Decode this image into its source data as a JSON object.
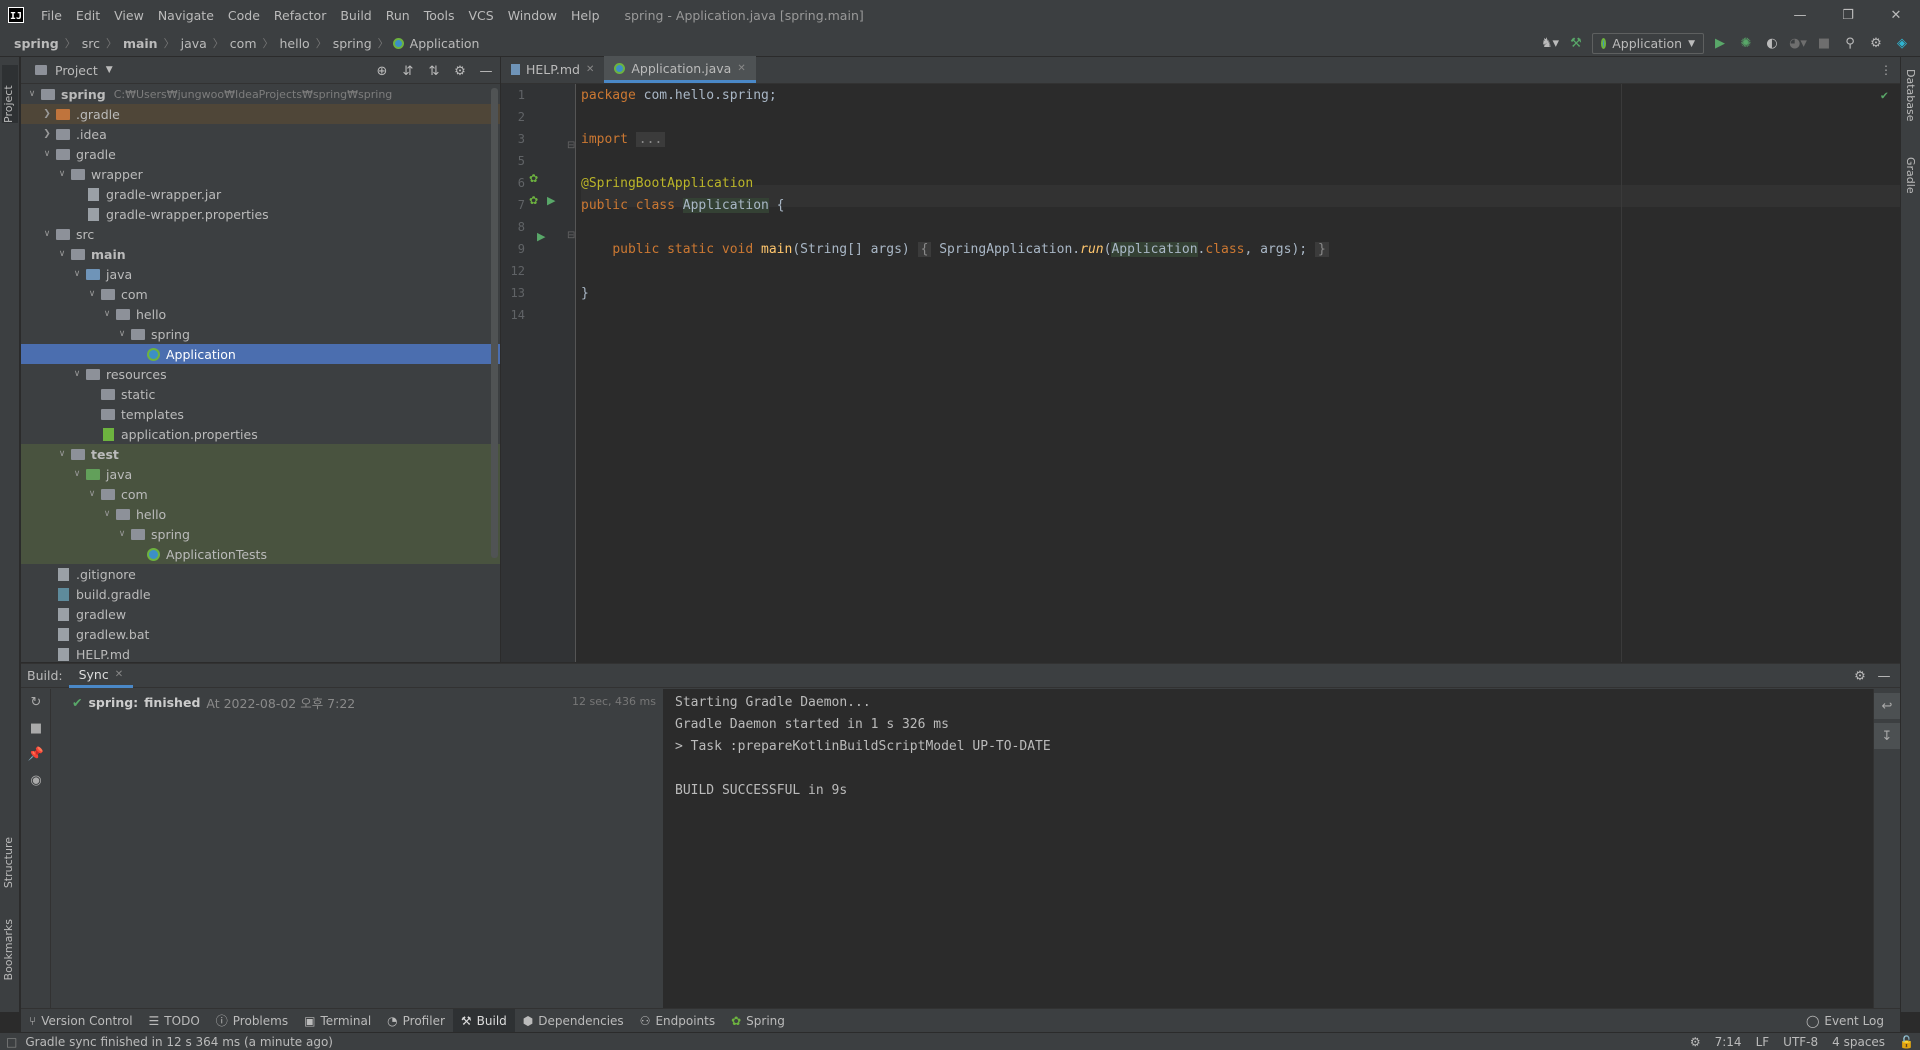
{
  "window": {
    "title": "spring - Application.java [spring.main]"
  },
  "menu": [
    "File",
    "Edit",
    "View",
    "Navigate",
    "Code",
    "Refactor",
    "Build",
    "Run",
    "Tools",
    "VCS",
    "Window",
    "Help"
  ],
  "breadcrumb": [
    "spring",
    "src",
    "main",
    "java",
    "com",
    "hello",
    "spring",
    "Application"
  ],
  "run_config": "Application",
  "left_tabs": {
    "project": "Project",
    "structure": "Structure",
    "bookmarks": "Bookmarks"
  },
  "right_tabs": {
    "database": "Database",
    "gradle": "Gradle"
  },
  "project_panel": {
    "title": "Project",
    "tree": [
      {
        "label": "spring",
        "path": "C:₩Users₩jungwoo₩IdeaProjects₩spring₩spring",
        "depth": 0,
        "arrow": "open",
        "icon": "folder-module",
        "bold": true
      },
      {
        "label": ".gradle",
        "depth": 1,
        "arrow": "closed",
        "icon": "folder-orange",
        "bg": "gradle"
      },
      {
        "label": ".idea",
        "depth": 1,
        "arrow": "closed",
        "icon": "folder"
      },
      {
        "label": "gradle",
        "depth": 1,
        "arrow": "open",
        "icon": "folder"
      },
      {
        "label": "wrapper",
        "depth": 2,
        "arrow": "open",
        "icon": "folder"
      },
      {
        "label": "gradle-wrapper.jar",
        "depth": 3,
        "arrow": "none",
        "icon": "file"
      },
      {
        "label": "gradle-wrapper.properties",
        "depth": 3,
        "arrow": "none",
        "icon": "file"
      },
      {
        "label": "src",
        "depth": 1,
        "arrow": "open",
        "icon": "folder"
      },
      {
        "label": "main",
        "depth": 2,
        "arrow": "open",
        "icon": "folder",
        "bold": true
      },
      {
        "label": "java",
        "depth": 3,
        "arrow": "open",
        "icon": "folder-blue"
      },
      {
        "label": "com",
        "depth": 4,
        "arrow": "open",
        "icon": "folder"
      },
      {
        "label": "hello",
        "depth": 5,
        "arrow": "open",
        "icon": "folder"
      },
      {
        "label": "spring",
        "depth": 6,
        "arrow": "open",
        "icon": "folder"
      },
      {
        "label": "Application",
        "depth": 7,
        "arrow": "none",
        "icon": "spring",
        "selected": true
      },
      {
        "label": "resources",
        "depth": 3,
        "arrow": "open",
        "icon": "folder"
      },
      {
        "label": "static",
        "depth": 4,
        "arrow": "none",
        "icon": "folder"
      },
      {
        "label": "templates",
        "depth": 4,
        "arrow": "none",
        "icon": "folder"
      },
      {
        "label": "application.properties",
        "depth": 4,
        "arrow": "none",
        "icon": "spring-leaf"
      },
      {
        "label": "test",
        "depth": 2,
        "arrow": "open",
        "icon": "folder",
        "bold": true,
        "bg": "test"
      },
      {
        "label": "java",
        "depth": 3,
        "arrow": "open",
        "icon": "folder-green",
        "bg": "test"
      },
      {
        "label": "com",
        "depth": 4,
        "arrow": "open",
        "icon": "folder",
        "bg": "test"
      },
      {
        "label": "hello",
        "depth": 5,
        "arrow": "open",
        "icon": "folder",
        "bg": "test"
      },
      {
        "label": "spring",
        "depth": 6,
        "arrow": "open",
        "icon": "folder",
        "bg": "test"
      },
      {
        "label": "ApplicationTests",
        "depth": 7,
        "arrow": "none",
        "icon": "spring",
        "bg": "test"
      },
      {
        "label": ".gitignore",
        "depth": 1,
        "arrow": "none",
        "icon": "file"
      },
      {
        "label": "build.gradle",
        "depth": 1,
        "arrow": "none",
        "icon": "gradle"
      },
      {
        "label": "gradlew",
        "depth": 1,
        "arrow": "none",
        "icon": "file"
      },
      {
        "label": "gradlew.bat",
        "depth": 1,
        "arrow": "none",
        "icon": "file"
      },
      {
        "label": "HELP.md",
        "depth": 1,
        "arrow": "none",
        "icon": "file"
      }
    ]
  },
  "editor": {
    "tabs": [
      {
        "label": "HELP.md",
        "active": false
      },
      {
        "label": "Application.java",
        "active": true
      }
    ],
    "line_numbers": [
      "1",
      "2",
      "3",
      "5",
      "6",
      "7",
      "8",
      "9",
      "12",
      "13",
      "14"
    ],
    "lines": {
      "l1_kw": "package",
      "l1_rest": " com.hello.spring;",
      "l3_kw": "import",
      "l3_fold": "...",
      "l6_ann": "@SpringBootApplication",
      "l7_kw": "public class",
      "l7_cls": "Application",
      "l7_rest": " {",
      "l9_kw": "public static void",
      "l9_fn": "main",
      "l9_args": "(String[] args)",
      "l9_open": "{",
      "l9_sa": "SpringApplication.",
      "l9_run": "run",
      "l9_cls": "Application",
      "l9_dot": ".",
      "l9_kwclass": "class",
      "l9_rest": ", args);",
      "l9_close": "}",
      "l13": "}"
    }
  },
  "build": {
    "label": "Build:",
    "tab": "Sync",
    "entry_name": "spring:",
    "entry_status": "finished",
    "entry_time": "At 2022-08-02 오후 7:22",
    "entry_duration": "12 sec, 436 ms",
    "console": [
      "Starting Gradle Daemon...",
      "Gradle Daemon started in 1 s 326 ms",
      "> Task :prepareKotlinBuildScriptModel UP-TO-DATE",
      "",
      "BUILD SUCCESSFUL in 9s"
    ]
  },
  "bottom_tabs": [
    "Version Control",
    "TODO",
    "Problems",
    "Terminal",
    "Profiler",
    "Build",
    "Dependencies",
    "Endpoints",
    "Spring"
  ],
  "event_log": "Event Log",
  "status": {
    "message": "Gradle sync finished in 12 s 364 ms (a minute ago)",
    "position": "7:14",
    "line_sep": "LF",
    "encoding": "UTF-8",
    "indent": "4 spaces"
  },
  "colors": {
    "accent": "#4a88c7",
    "selection": "#4b6eaf",
    "run": "#59a869"
  }
}
